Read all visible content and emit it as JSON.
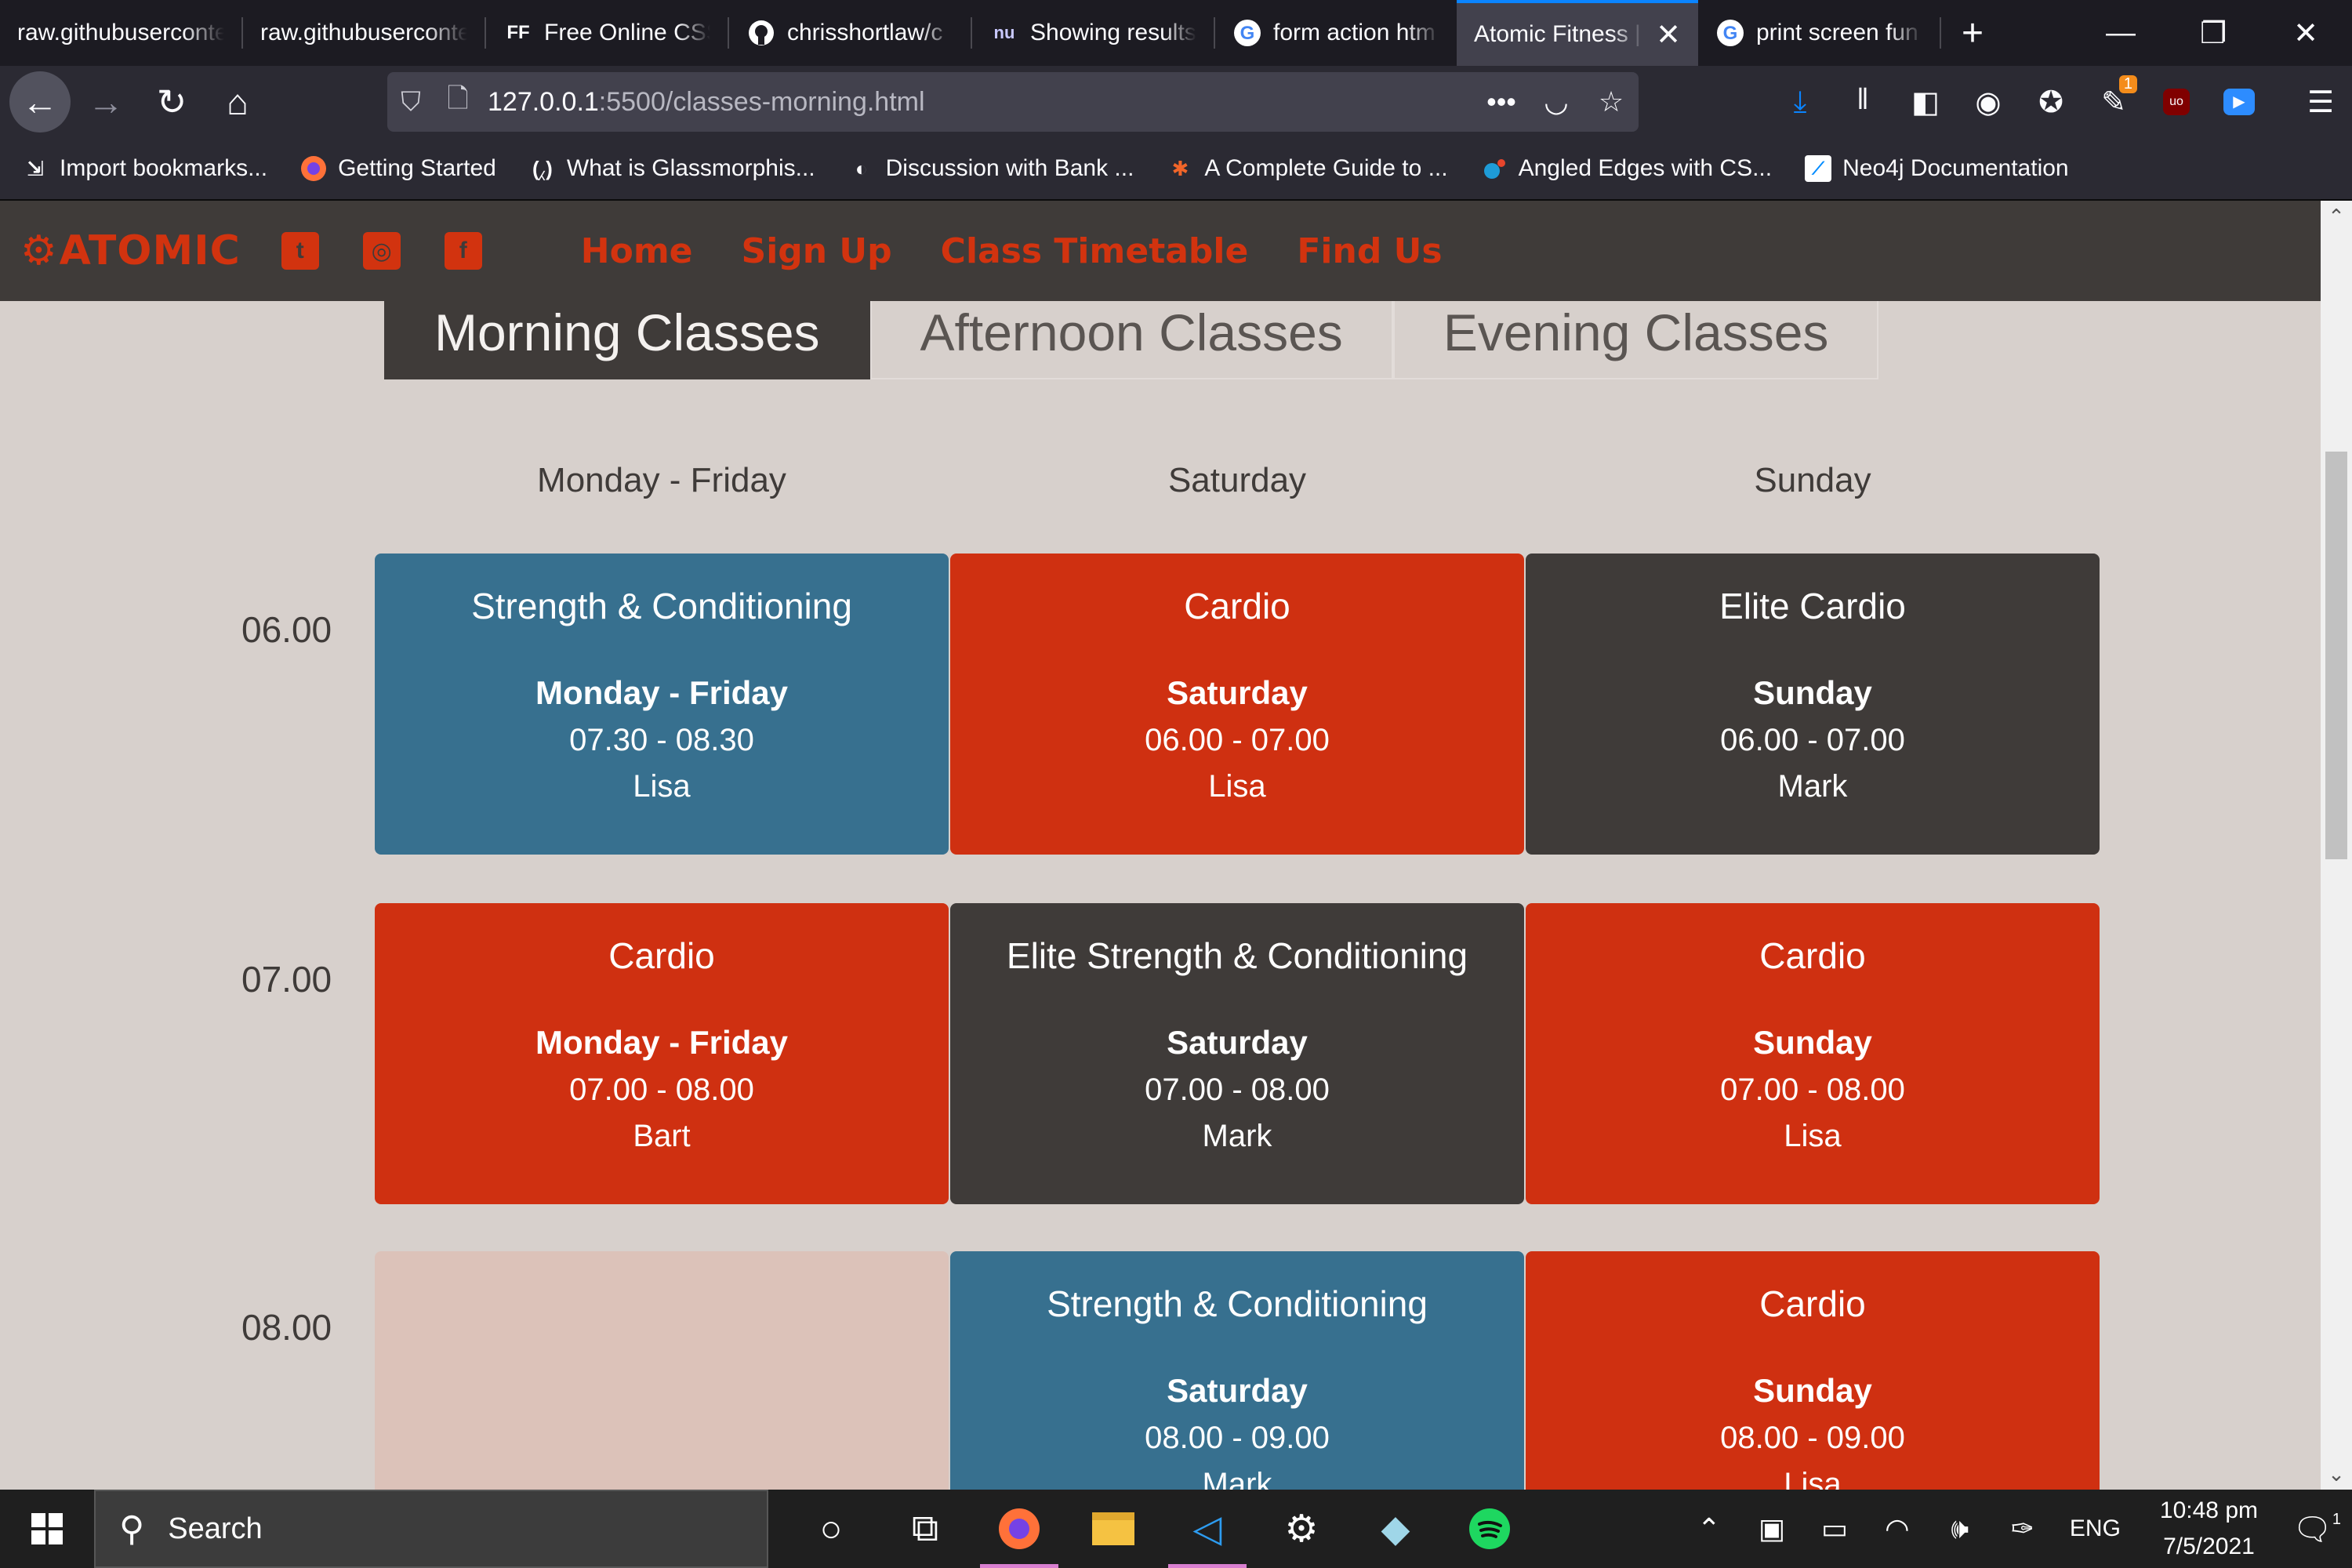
{
  "browser": {
    "tabs": [
      {
        "label": "raw.githubusercontent",
        "icon": ""
      },
      {
        "label": "raw.githubusercontent",
        "icon": ""
      },
      {
        "label": "Free Online CSS",
        "icon": "FF"
      },
      {
        "label": "chrisshortlaw/c",
        "icon": "github-icon"
      },
      {
        "label": "Showing results",
        "icon": "nu"
      },
      {
        "label": "form action htm",
        "icon": "google-icon"
      },
      {
        "label": "Atomic Fitness |",
        "icon": "",
        "active": true
      },
      {
        "label": "print screen fun",
        "icon": "google-icon"
      }
    ],
    "url_host": "127.0.0.1",
    "url_path": ":5500/classes-morning.html",
    "bookmarks": [
      "Import bookmarks...",
      "Getting Started",
      "What is Glassmorphis...",
      "Discussion with Bank ...",
      "A Complete Guide to ...",
      "Angled Edges with CS...",
      "Neo4j Documentation"
    ],
    "downloads_badge": "1"
  },
  "site": {
    "logo": "ATOMIC",
    "brand_color": "#d2330f",
    "nav": [
      "Home",
      "Sign Up",
      "Class Timetable",
      "Find Us"
    ],
    "class_tabs": [
      {
        "label": "Morning Classes",
        "active": true
      },
      {
        "label": "Afternoon Classes",
        "active": false
      },
      {
        "label": "Evening Classes",
        "active": false
      }
    ],
    "days": [
      "Monday - Friday",
      "Saturday",
      "Sunday"
    ],
    "times": [
      "06.00",
      "07.00",
      "08.00"
    ],
    "rows": [
      [
        {
          "title": "Strength & Conditioning",
          "day": "Monday - Friday",
          "time": "07.30 - 08.30",
          "coach": "Lisa",
          "color": "blue"
        },
        {
          "title": "Cardio",
          "day": "Saturday",
          "time": "06.00 - 07.00",
          "coach": "Lisa",
          "color": "red"
        },
        {
          "title": "Elite Cardio",
          "day": "Sunday",
          "time": "06.00 - 07.00",
          "coach": "Mark",
          "color": "dark"
        }
      ],
      [
        {
          "title": "Cardio",
          "day": "Monday - Friday",
          "time": "07.00 - 08.00",
          "coach": "Bart",
          "color": "red"
        },
        {
          "title": "Elite Strength & Conditioning",
          "day": "Saturday",
          "time": "07.00 - 08.00",
          "coach": "Mark",
          "color": "dark"
        },
        {
          "title": "Cardio",
          "day": "Sunday",
          "time": "07.00 - 08.00",
          "coach": "Lisa",
          "color": "red"
        }
      ],
      [
        {
          "title": "",
          "day": "",
          "time": "",
          "coach": "",
          "color": "empty"
        },
        {
          "title": "Strength & Conditioning",
          "day": "Saturday",
          "time": "08.00 - 09.00",
          "coach": "Mark",
          "color": "blue"
        },
        {
          "title": "Cardio",
          "day": "Sunday",
          "time": "08.00 - 09.00",
          "coach": "Lisa",
          "color": "red"
        }
      ]
    ],
    "colors": {
      "blue": "#37708f",
      "red": "#cf3011",
      "dark": "#3f3b39",
      "empty": "#dcc2b9"
    }
  },
  "taskbar": {
    "search_placeholder": "Search",
    "language": "ENG",
    "time": "10:48 pm",
    "date": "7/5/2021",
    "notification_count": "1"
  }
}
